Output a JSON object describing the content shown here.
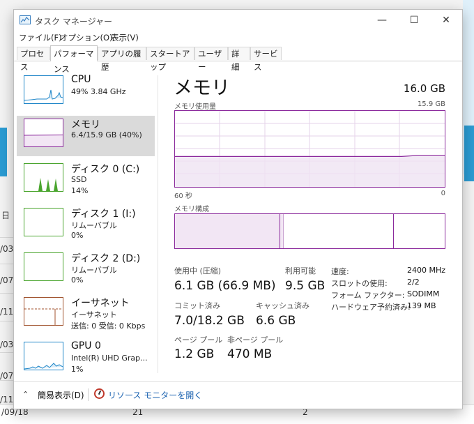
{
  "window": {
    "title": "タスク マネージャー",
    "buttons": {
      "minimize": "—",
      "maximize": "☐",
      "close": "✕"
    }
  },
  "menu": [
    "ファイル(F)",
    "オプション(O)",
    "表示(V)"
  ],
  "tabs": [
    {
      "label": "プロセス",
      "active": false
    },
    {
      "label": "パフォーマンス",
      "active": true
    },
    {
      "label": "アプリの履歴",
      "active": false
    },
    {
      "label": "スタートアップ",
      "active": false
    },
    {
      "label": "ユーザー",
      "active": false
    },
    {
      "label": "詳細",
      "active": false
    },
    {
      "label": "サービス",
      "active": false
    }
  ],
  "sidebar": {
    "items": [
      {
        "title": "CPU",
        "line1": "49%  3.84 GHz",
        "line2": "",
        "line3": "",
        "color": "#1f86c8",
        "selected": false
      },
      {
        "title": "メモリ",
        "line1": "6.4/15.9 GB (40%)",
        "line2": "",
        "line3": "",
        "color": "#8b2a9c",
        "selected": true
      },
      {
        "title": "ディスク 0 (C:)",
        "line1": "SSD",
        "line2": "14%",
        "line3": "",
        "color": "#4aa52e",
        "selected": false
      },
      {
        "title": "ディスク 1 (I:)",
        "line1": "リムーバブル",
        "line2": "0%",
        "line3": "",
        "color": "#4aa52e",
        "selected": false
      },
      {
        "title": "ディスク 2 (D:)",
        "line1": "リムーバブル",
        "line2": "0%",
        "line3": "",
        "color": "#4aa52e",
        "selected": false
      },
      {
        "title": "イーサネット",
        "line1": "イーサネット",
        "line2": "送信: 0 受信: 0 Kbps",
        "line3": "",
        "color": "#a0522d",
        "selected": false
      },
      {
        "title": "GPU 0",
        "line1": "Intel(R) UHD Grap...",
        "line2": "1%",
        "line3": "",
        "color": "#1f86c8",
        "selected": false
      }
    ]
  },
  "main": {
    "title": "メモリ",
    "total": "16.0 GB",
    "usage_label": "メモリ使用量",
    "usage_max": "15.9 GB",
    "axis_left": "60 秒",
    "axis_right": "0",
    "usage_fraction": 0.4,
    "composition_label": "メモリ構成",
    "stats": {
      "in_use_label": "使用中 (圧縮)",
      "in_use_value": "6.1 GB (66.9 MB)",
      "available_label": "利用可能",
      "available_value": "9.5 GB",
      "committed_label": "コミット済み",
      "committed_value": "7.0/18.2 GB",
      "cached_label": "キャッシュ済み",
      "cached_value": "6.6 GB",
      "paged_label": "ページ プール",
      "paged_value": "1.2 GB",
      "nonpaged_label": "非ページ プール",
      "nonpaged_value": "470 MB"
    },
    "details": [
      {
        "label": "速度:",
        "value": "2400 MHz"
      },
      {
        "label": "スロットの使用:",
        "value": "2/2"
      },
      {
        "label": "フォーム ファクター:",
        "value": "SODIMM"
      },
      {
        "label": "ハードウェア予約済み:",
        "value": "139 MB"
      }
    ]
  },
  "bottom": {
    "fewer_details": "簡易表示(D)",
    "resource_monitor": "リソース モニターを開く"
  },
  "background": {
    "texts": [
      "日",
      "/03/",
      "/07/",
      "/11/",
      "/03/",
      "/07/",
      "/11/",
      "/09/18",
      "21",
      "2"
    ]
  }
}
